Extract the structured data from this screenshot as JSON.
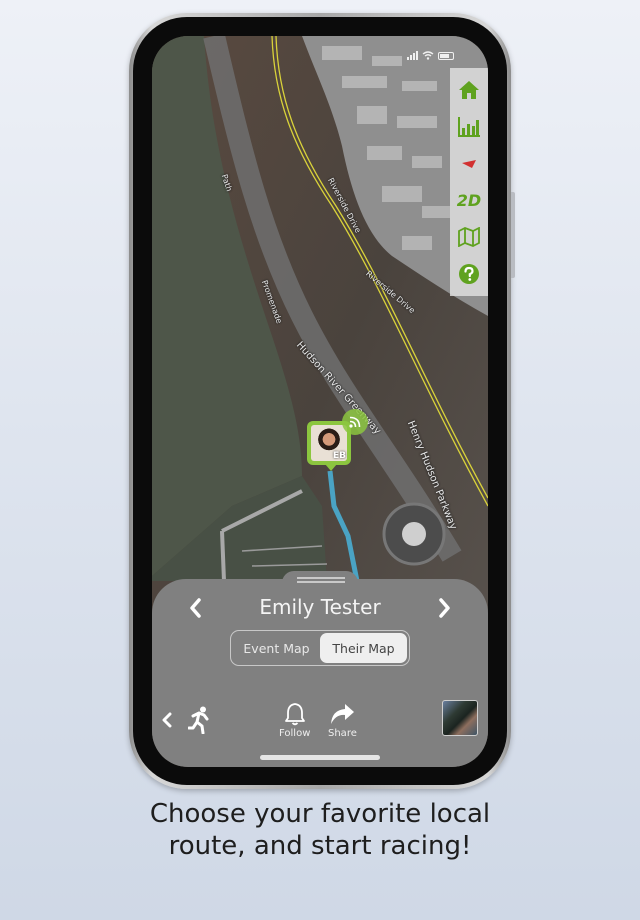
{
  "status_bar": {
    "signal_icon": "cellular-signal-icon",
    "wifi_icon": "wifi-icon",
    "battery_icon": "battery-icon"
  },
  "map": {
    "labels": {
      "greenway": "Hudson River Greenway",
      "parkway": "Henry Hudson Parkway",
      "riverside_1": "Riverside Drive",
      "riverside_2": "Riverside Drive",
      "promenade": "Promenade",
      "path": "Path"
    },
    "route_color": "#4aa3c4",
    "road_color": "#d9d23a"
  },
  "toolbar": {
    "items": [
      {
        "icon": "home-icon",
        "label": ""
      },
      {
        "icon": "bar-chart-icon",
        "label": ""
      },
      {
        "icon": "compass-arrow-icon",
        "label": ""
      },
      {
        "icon": "2d-view-toggle",
        "label": "2D"
      },
      {
        "icon": "map-icon",
        "label": ""
      },
      {
        "icon": "help-icon",
        "label": ""
      }
    ],
    "accent": "#5fa21f"
  },
  "participant_pin": {
    "initials": "EB",
    "live_icon": "live-broadcast-icon",
    "accent": "#8cc63f"
  },
  "sheet": {
    "name": "Emily Tester",
    "prev_icon": "chevron-left-icon",
    "next_icon": "chevron-right-icon",
    "segments": [
      {
        "label": "Event Map",
        "active": false
      },
      {
        "label": "Their Map",
        "active": true
      }
    ],
    "actions": {
      "back_icon": "chevron-left-icon",
      "activity_icon": "running-person-icon",
      "follow_label": "Follow",
      "share_label": "Share"
    }
  },
  "caption": {
    "line1": "Choose your favorite local",
    "line2": "route, and start racing!"
  }
}
